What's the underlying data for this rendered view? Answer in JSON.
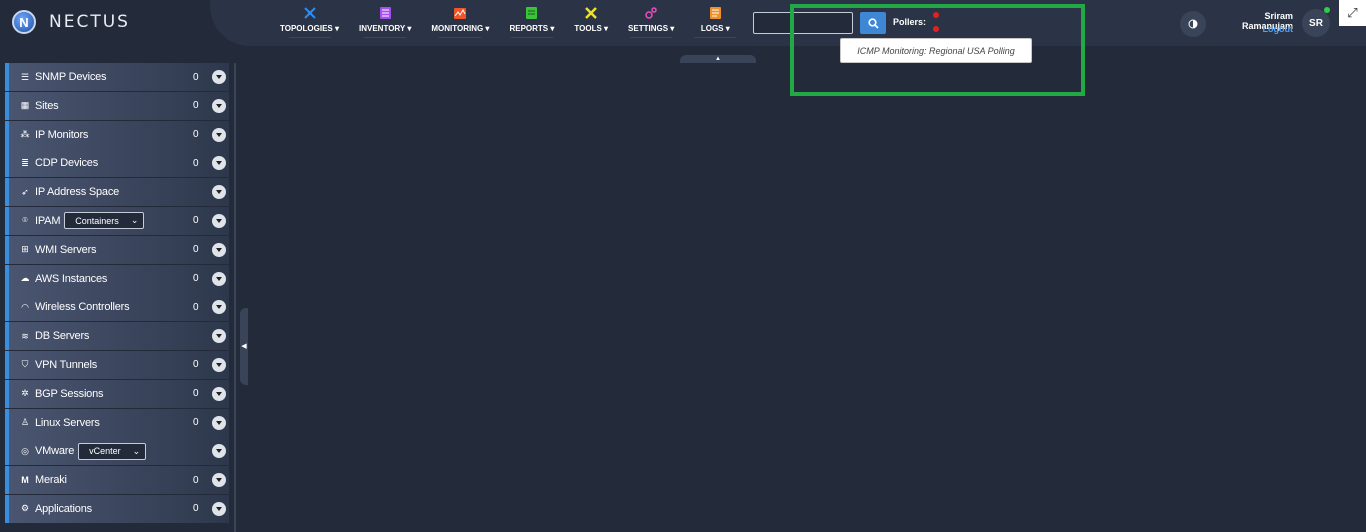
{
  "app": {
    "name": "NECTUS",
    "logo_letter": "N"
  },
  "nav": [
    {
      "label": "TOPOLOGIES",
      "icon": "topology-icon",
      "color": "#2a8cf0"
    },
    {
      "label": "INVENTORY",
      "icon": "inventory-icon",
      "color": "#a64ef0"
    },
    {
      "label": "MONITORING",
      "icon": "monitoring-icon",
      "color": "#f0552a"
    },
    {
      "label": "REPORTS",
      "icon": "reports-icon",
      "color": "#3ac43a"
    },
    {
      "label": "TOOLS",
      "icon": "tools-icon",
      "color": "#f0e02a"
    },
    {
      "label": "SETTINGS",
      "icon": "settings-icon",
      "color": "#f04ac0"
    },
    {
      "label": "LOGS",
      "icon": "logs-icon",
      "color": "#f0902a"
    }
  ],
  "search": {
    "value": "",
    "placeholder": ""
  },
  "pollers": {
    "label": "Pollers:",
    "status_color": "#e52020",
    "tooltip": "ICMP Monitoring: Regional USA Polling"
  },
  "user": {
    "name": "Sriram Ramanujam",
    "logout": "Logout",
    "initials": "SR",
    "online_color": "#2fce4a"
  },
  "sidebar": {
    "items": [
      {
        "label": "SNMP Devices",
        "icon": "database-icon",
        "count": "0"
      },
      {
        "label": "Sites",
        "icon": "building-icon",
        "count": "0"
      },
      {
        "label": "IP Monitors",
        "icon": "network-icon",
        "count": "0"
      },
      {
        "label": "CDP Devices",
        "icon": "server-icon",
        "count": "0"
      },
      {
        "label": "IP Address Space",
        "icon": "rocket-icon",
        "count": ""
      },
      {
        "label": "IPAM",
        "icon": "map-pin-icon",
        "count": "0",
        "select": "Containers"
      },
      {
        "label": "WMI Servers",
        "icon": "windows-icon",
        "count": "0"
      },
      {
        "label": "AWS Instances",
        "icon": "cloud-icon",
        "count": "0"
      },
      {
        "label": "Wireless Controllers",
        "icon": "wifi-icon",
        "count": "0"
      },
      {
        "label": "DB Servers",
        "icon": "db-server-icon",
        "count": ""
      },
      {
        "label": "VPN Tunnels",
        "icon": "shield-icon",
        "count": "0"
      },
      {
        "label": "BGP Sessions",
        "icon": "cog-icon",
        "count": "0"
      },
      {
        "label": "Linux Servers",
        "icon": "linux-icon",
        "count": "0"
      },
      {
        "label": "VMware",
        "icon": "vmware-icon",
        "count": "",
        "select": "vCenter"
      },
      {
        "label": "Meraki",
        "icon": "meraki-icon",
        "count": "0"
      },
      {
        "label": "Applications",
        "icon": "gear-icon",
        "count": "0"
      }
    ]
  },
  "colors": {
    "accent": "#3a8ee0",
    "highlight": "#22a845",
    "search_button": "#3e87d4"
  }
}
